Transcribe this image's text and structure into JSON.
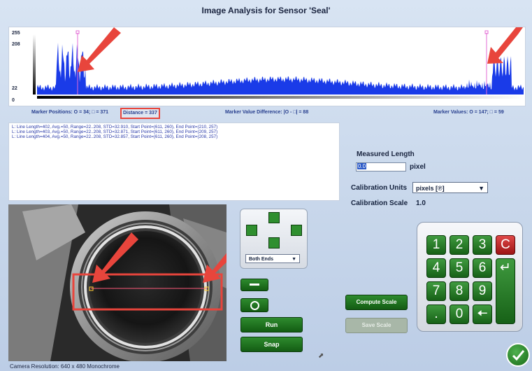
{
  "window": {
    "title": "Image Analysis for Sensor 'Seal'"
  },
  "histogram": {
    "y_ticks": [
      "255",
      "208",
      "22",
      "0"
    ]
  },
  "marker_bar": {
    "positions": "Marker Positions: O = 34; □ = 371",
    "distance": "Distance = 337",
    "difference": "Marker Value Difference: |O - □| = 88",
    "values": "Marker Values: O = 147; □ = 59"
  },
  "log": {
    "lines": [
      "L: Line Length=402, Avg.=50, Range=22..208, STD=32.910, Start Point=(611, 260), End Point=(210, 257)",
      "L: Line Length=403, Avg.=50, Range=22..208, STD=32.871, Start Point=(611, 260), End Point=(209, 257)",
      "L: Line Length=404, Avg.=50, Range=22..208, STD=32.857, Start Point=(611, 260), End Point=(208, 257)"
    ]
  },
  "measure": {
    "label": "Measured Length",
    "value": "0.0",
    "unit": "pixel"
  },
  "calibration": {
    "units_label": "Calibration Units",
    "units_value": "pixels [℗]",
    "scale_label": "Calibration Scale",
    "scale_value": "1.0"
  },
  "controls": {
    "ends_select": "Both Ends",
    "run": "Run",
    "snap": "Snap",
    "compute_scale": "Compute Scale",
    "save_scale": "Save Scale"
  },
  "keypad": {
    "keys": [
      "1",
      "2",
      "3",
      "C",
      "4",
      "5",
      "6",
      "7",
      "8",
      "9",
      ".",
      "0"
    ]
  },
  "camera": {
    "resolution": "Camera Resolution: 640 x 480 Monochrome"
  },
  "colors": {
    "accent": "#2e8b2e",
    "histogram": "#1a3be8",
    "annotation": "#e8453c",
    "marker": "#e36bd6"
  }
}
